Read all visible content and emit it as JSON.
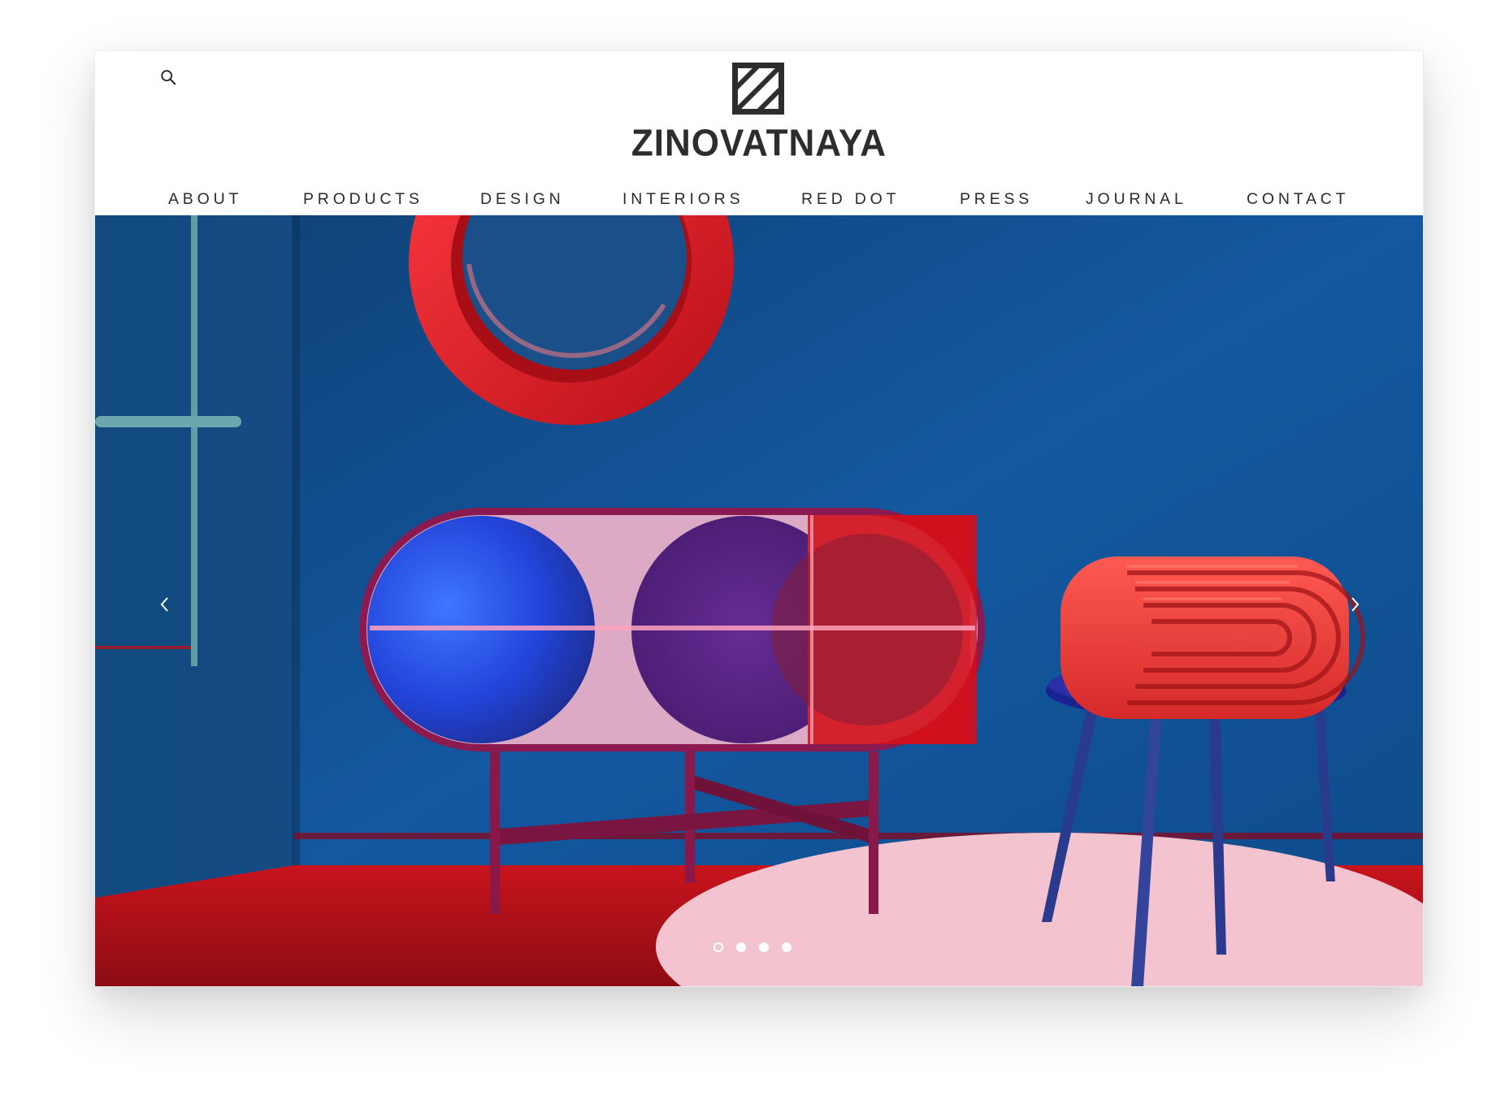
{
  "brand": {
    "name": "ZINOVATNAYA",
    "logo_icon": "diagonal-stripes-square-logo"
  },
  "header": {
    "search_icon": "search-icon"
  },
  "nav": {
    "items": [
      {
        "label": "ABOUT"
      },
      {
        "label": "PRODUCTS"
      },
      {
        "label": "DESIGN"
      },
      {
        "label": "INTERIORS"
      },
      {
        "label": "RED DOT"
      },
      {
        "label": "PRESS"
      },
      {
        "label": "JOURNAL"
      },
      {
        "label": "CONTACT"
      }
    ]
  },
  "hero": {
    "image_subject": "blue room with red round mirror, pill-shaped translucent cabinet and striped red chair",
    "prev_icon": "chevron-left-icon",
    "next_icon": "chevron-right-icon",
    "slides_total": 4,
    "active_slide": 1
  },
  "colors": {
    "wall_blue": "#114b86",
    "floor_red": "#b5121b",
    "accent_red": "#e23a3a",
    "text_dark": "#2b2b2b"
  }
}
